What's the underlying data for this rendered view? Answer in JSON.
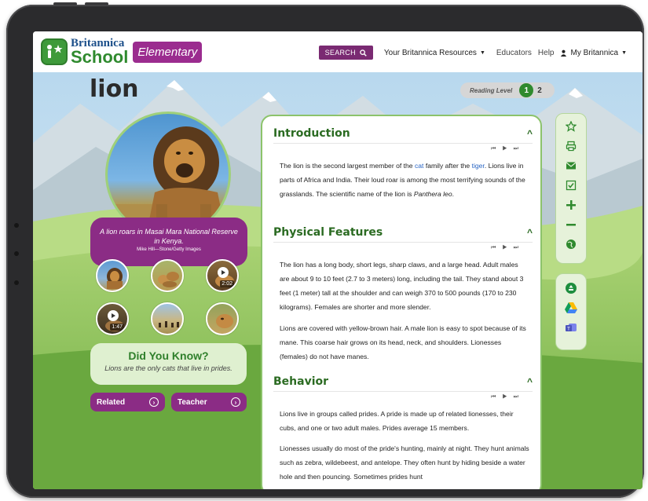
{
  "header": {
    "logo_brand": "Britannica",
    "logo_product": "School",
    "logo_edition": "Elementary",
    "search_label": "SEARCH",
    "nav": {
      "resources": "Your Britannica Resources",
      "educators": "Educators",
      "help": "Help",
      "account": "My Britannica"
    }
  },
  "page": {
    "title": "lion",
    "reading_level_label": "Reading Level",
    "reading_level_active": "1",
    "reading_level_other": "2"
  },
  "media": {
    "caption": "A lion roars in Masai Mara National Reserve in Kenya.",
    "credit": "Mike Hill—Stone/Getty Images",
    "thumb_durations": [
      "2:02",
      "1:47"
    ]
  },
  "did_you_know": {
    "title": "Did You Know?",
    "text": "Lions are the only cats that live in prides."
  },
  "buttons": {
    "related": "Related",
    "teacher": "Teacher"
  },
  "article": {
    "sections": [
      {
        "heading": "Introduction",
        "paragraphs": [
          {
            "before": "The lion is the second largest member of the ",
            "link1": "cat",
            "middle": " family after the ",
            "link2": "tiger",
            "after": ". Lions live in parts of Africa and India. Their loud roar is among the most terrifying sounds of the grasslands. The scientific name of the lion is ",
            "italic": "Panthera leo",
            "end": "."
          }
        ]
      },
      {
        "heading": "Physical Features",
        "paragraphs": [
          "The lion has a long body, short legs, sharp claws, and a large head. Adult males are about 9 to 10 feet (2.7 to 3 meters) long, including the tail. They stand about 3 feet (1 meter) tall at the shoulder and can weigh 370 to 500 pounds (170 to 230 kilograms). Females are shorter and more slender.",
          "Lions are covered with yellow-brown hair. A male lion is easy to spot because of its mane. This coarse hair grows on its head, neck, and shoulders. Lionesses (females) do not have manes."
        ]
      },
      {
        "heading": "Behavior",
        "paragraphs": [
          "Lions live in groups called prides. A pride is made up of related lionesses, their cubs, and one or two adult males. Prides average 15 members.",
          "Lionesses usually do most of the pride's hunting, mainly at night. They hunt animals such as zebra, wildebeest, and antelope. They often hunt by hiding beside a water hole and then pouncing. Sometimes prides hunt"
        ]
      }
    ]
  },
  "tools": [
    "star-icon",
    "print-icon",
    "email-icon",
    "checklist-icon",
    "plus-icon",
    "minus-icon",
    "globe-icon"
  ],
  "share": [
    "google-classroom-icon",
    "google-drive-icon",
    "microsoft-teams-icon"
  ],
  "colors": {
    "brand_green": "#2f8a2e",
    "brand_purple": "#8b2c85",
    "link_blue": "#2a66c4"
  }
}
